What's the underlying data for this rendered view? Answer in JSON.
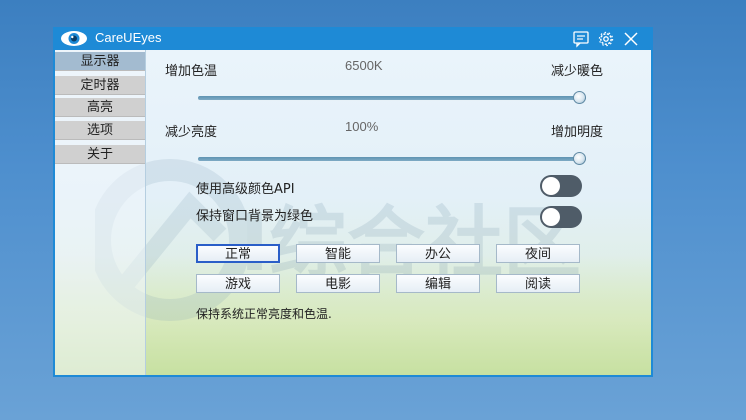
{
  "window": {
    "title": "CareUEyes"
  },
  "sidebar": {
    "items": [
      {
        "label": "显示器",
        "active": true
      },
      {
        "label": "定时器",
        "active": false
      },
      {
        "label": "高亮",
        "active": false
      },
      {
        "label": "选项",
        "active": false
      },
      {
        "label": "关于",
        "active": false
      }
    ]
  },
  "temperature": {
    "left_label": "增加色温",
    "value": "6500K",
    "right_label": "减少暖色",
    "level": 1.0
  },
  "brightness": {
    "left_label": "减少亮度",
    "value": "100%",
    "right_label": "增加明度",
    "level": 1.0
  },
  "options": {
    "advanced_api": {
      "label": "使用高级颜色API",
      "on": false
    },
    "green_background": {
      "label": "保持窗口背景为绿色",
      "on": false
    }
  },
  "modes": [
    {
      "label": "正常",
      "selected": true
    },
    {
      "label": "智能",
      "selected": false
    },
    {
      "label": "办公",
      "selected": false
    },
    {
      "label": "夜间",
      "selected": false
    },
    {
      "label": "游戏",
      "selected": false
    },
    {
      "label": "电影",
      "selected": false
    },
    {
      "label": "编辑",
      "selected": false
    },
    {
      "label": "阅读",
      "selected": false
    }
  ],
  "status_text": "保持系统正常亮度和色温.",
  "watermark_text": "I综合社区",
  "colors": {
    "titlebar": "#1e8ad6",
    "toggle_off": "#4f5c68",
    "selected_border": "#2a5ec8"
  }
}
